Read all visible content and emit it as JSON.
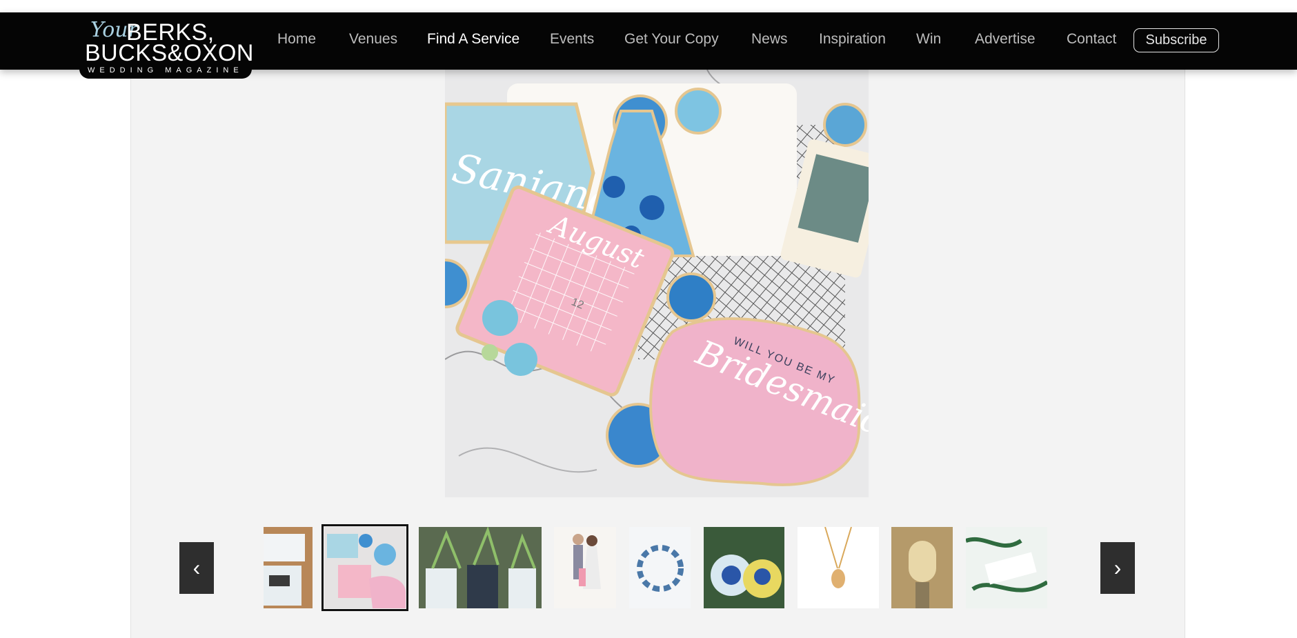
{
  "brand": {
    "your": "Your",
    "line1": "BERKS,",
    "line2": "BUCKS&OXON",
    "tagline": "WEDDING MAGAZINE"
  },
  "nav": {
    "items": [
      {
        "label": "Home",
        "active": false
      },
      {
        "label": "Venues",
        "active": false
      },
      {
        "label": "Find A Service",
        "active": true
      },
      {
        "label": "Events",
        "active": false
      },
      {
        "label": "Get Your Copy",
        "active": false
      },
      {
        "label": "News",
        "active": false
      },
      {
        "label": "Inspiration",
        "active": false
      },
      {
        "label": "Win",
        "active": false
      },
      {
        "label": "Advertise",
        "active": false
      },
      {
        "label": "Contact",
        "active": false
      }
    ],
    "subscribe": "Subscribe"
  },
  "hero": {
    "name_cookie": "Sanjana",
    "month_cookie": "August",
    "date_number": "12",
    "question_top": "WILL YOU BE MY",
    "question_main": "Bridesmaid?"
  },
  "carousel": {
    "prev_label": "‹",
    "next_label": "›",
    "thumbnails": [
      {
        "label": "stationery-partial",
        "selected": false
      },
      {
        "label": "bridesmaid-cookies",
        "selected": true
      },
      {
        "label": "plant-pots",
        "selected": false
      },
      {
        "label": "couple-illustration",
        "selected": false
      },
      {
        "label": "floral-wreath-invite",
        "selected": false
      },
      {
        "label": "favour-bags",
        "selected": false
      },
      {
        "label": "gold-pendant",
        "selected": false
      },
      {
        "label": "venue-painting",
        "selected": false
      },
      {
        "label": "botanical-invitation",
        "selected": false
      }
    ]
  },
  "colors": {
    "accent_blue": "#a8cfe0",
    "cookie_pink": "#f0b7c9",
    "nav_bg": "#050505"
  }
}
